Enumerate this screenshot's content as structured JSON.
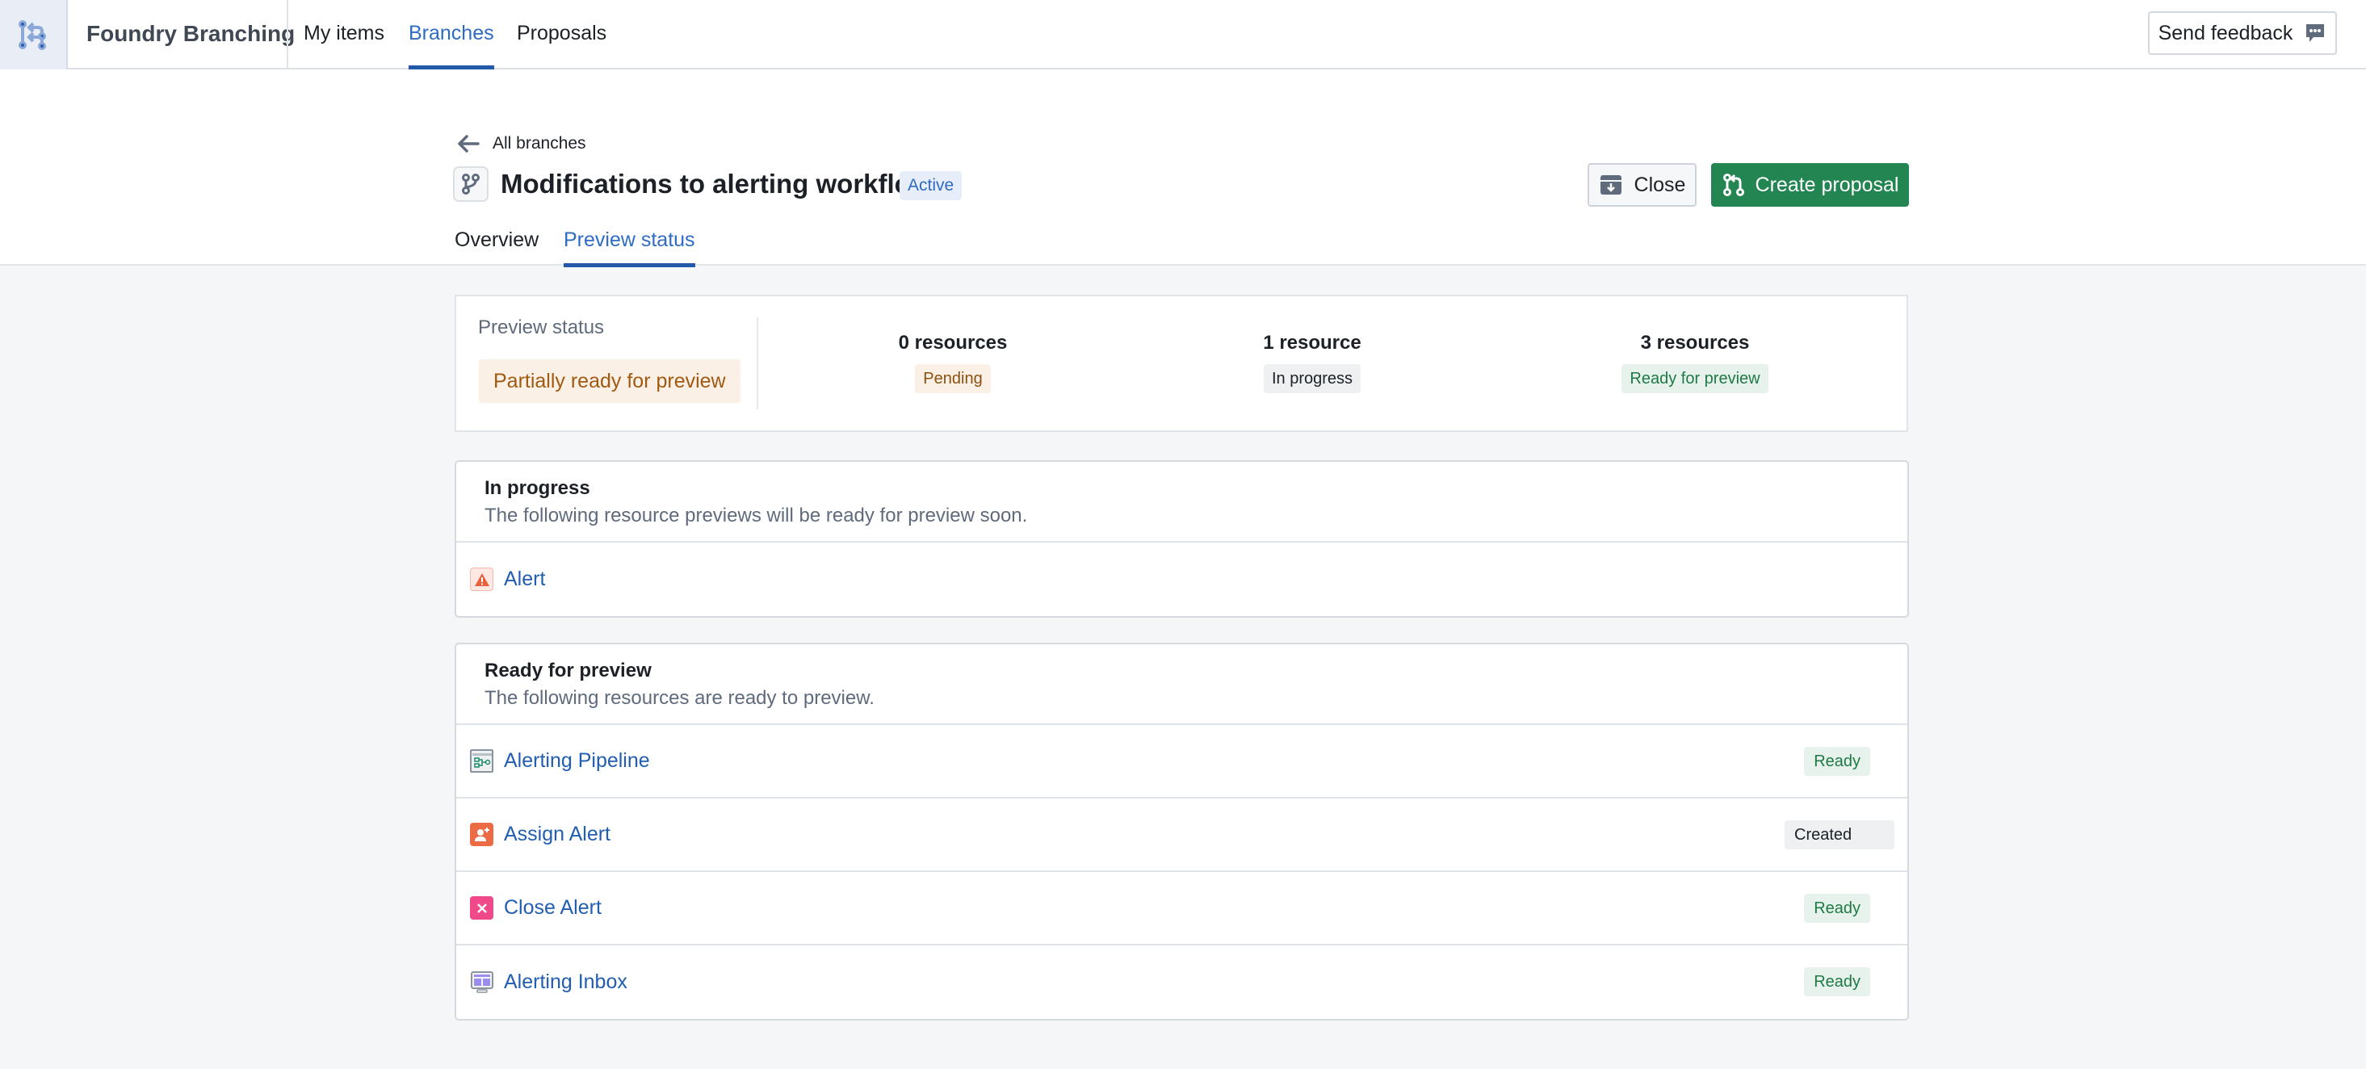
{
  "topnav": {
    "logo_icon": "branching-logo-icon",
    "app_title": "Foundry Branching",
    "tabs": [
      {
        "label": "My items",
        "active": false
      },
      {
        "label": "Branches",
        "active": true
      },
      {
        "label": "Proposals",
        "active": false
      }
    ],
    "feedback_label": "Send feedback",
    "feedback_icon": "chat-bubble-icon"
  },
  "branch": {
    "back_label": "All branches",
    "back_icon": "arrow-left-icon",
    "icon": "git-branch-icon",
    "title": "Modifications to alerting workflow",
    "status": "Active",
    "close_label": "Close",
    "close_icon": "archive-icon",
    "create_label": "Create proposal",
    "create_icon": "git-pull-icon",
    "tabs": [
      {
        "label": "Overview",
        "active": false
      },
      {
        "label": "Preview status",
        "active": true
      }
    ]
  },
  "summary": {
    "label": "Preview status",
    "overall_status": "Partially ready for preview",
    "stats": [
      {
        "count": "0 resources",
        "status": "Pending"
      },
      {
        "count": "1 resource",
        "status": "In progress"
      },
      {
        "count": "3 resources",
        "status": "Ready for preview"
      }
    ]
  },
  "in_progress": {
    "title": "In progress",
    "description": "The following resource previews will be ready for preview soon.",
    "items": [
      {
        "name": "Alert",
        "icon": "warning-triangle-icon"
      }
    ]
  },
  "ready": {
    "title": "Ready for preview",
    "description": "The following resources are ready to preview.",
    "items": [
      {
        "name": "Alerting Pipeline",
        "icon": "pipeline-icon",
        "status": "Ready"
      },
      {
        "name": "Assign Alert",
        "icon": "assign-user-icon",
        "status": "Created"
      },
      {
        "name": "Close Alert",
        "icon": "close-x-icon",
        "status": "Ready"
      },
      {
        "name": "Alerting Inbox",
        "icon": "workshop-app-icon",
        "status": "Ready"
      }
    ]
  },
  "colors": {
    "accent_blue": "#2d6bc4",
    "primary_green": "#238551",
    "pending_orange": "#a05a12",
    "ready_green": "#1d7a45"
  }
}
